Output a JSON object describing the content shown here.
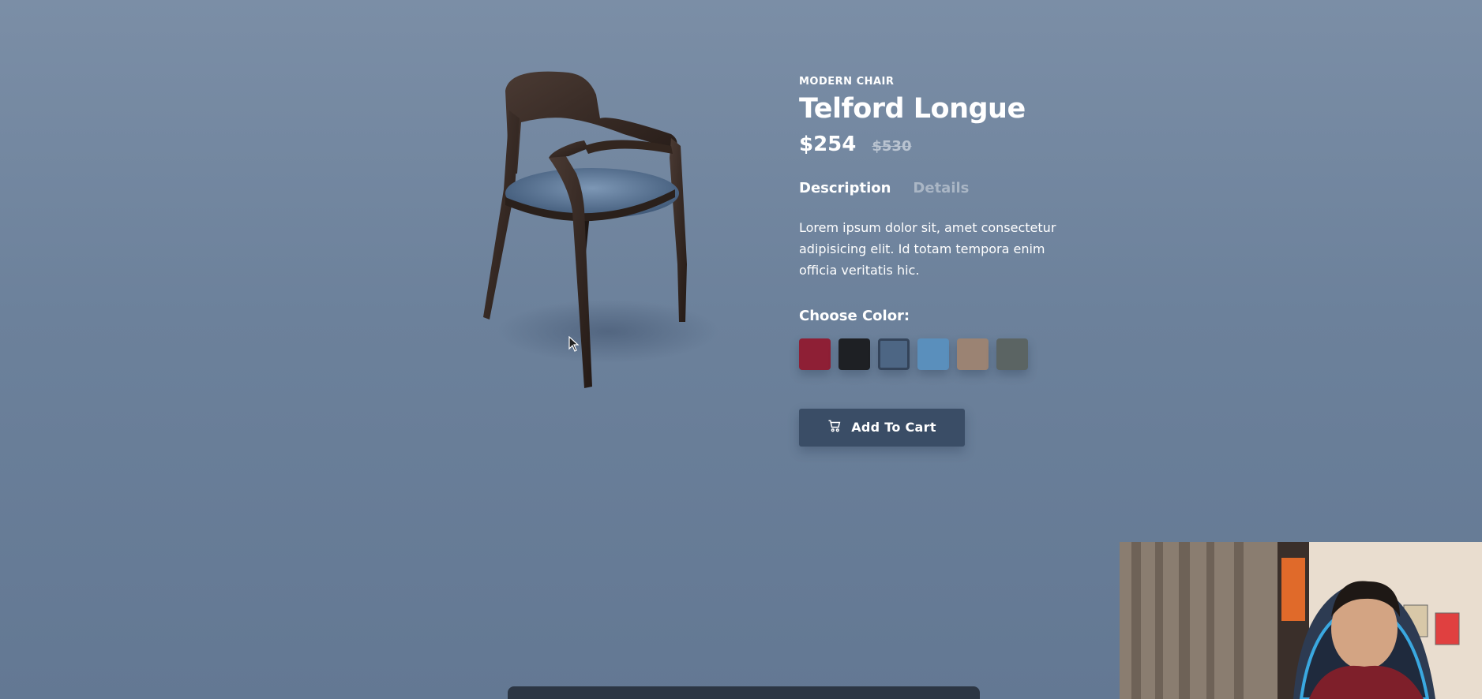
{
  "product": {
    "category": "MODERN CHAIR",
    "name": "Telford Longue",
    "price": "$254",
    "old_price": "$530"
  },
  "tabs": [
    {
      "label": "Description",
      "active": true
    },
    {
      "label": "Details",
      "active": false
    }
  ],
  "description": "Lorem ipsum dolor sit, amet consectetur adipisicing elit. Id totam tempora enim officia veritatis hic.",
  "color_picker": {
    "label": "Choose Color:",
    "selected": "blue-denim",
    "swatches": [
      {
        "name": "crimson",
        "color": "#8e1f35"
      },
      {
        "name": "black",
        "color": "#1e2024"
      },
      {
        "name": "blue-denim",
        "color": "#4d6684"
      },
      {
        "name": "light-blue",
        "color": "#5a8fbc"
      },
      {
        "name": "tan",
        "color": "#9b8373"
      },
      {
        "name": "gray",
        "color": "#5b6463"
      }
    ]
  },
  "cart_button": {
    "label": "Add To Cart",
    "icon": "cart-icon"
  },
  "colors": {
    "background": "#6f839d",
    "button": "#3a4d66",
    "text": "#ffffff",
    "muted": "#aab6c5"
  }
}
